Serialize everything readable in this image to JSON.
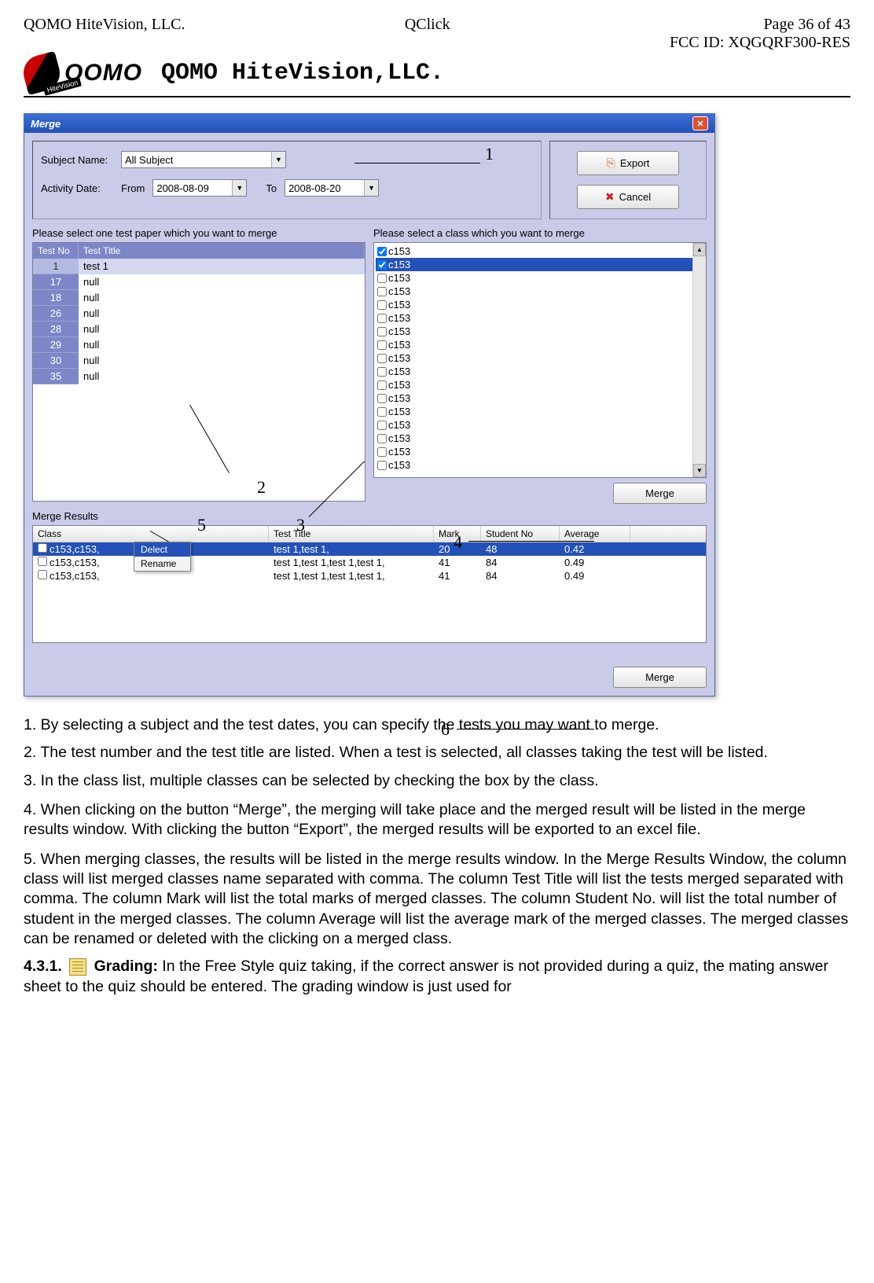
{
  "header": {
    "page": "Page 36 of 43",
    "left": "QOMO HiteVision, LLC.",
    "center": "QClick",
    "right": "FCC ID: XQGQRF300-RES",
    "logo_text": "QOMO",
    "logo_sub": "HiteVision",
    "company": "QOMO HiteVision,LLC."
  },
  "window": {
    "title": "Merge",
    "subject_label": "Subject Name:",
    "subject_value": "All Subject",
    "date_label": "Activity Date:",
    "from_label": "From",
    "from_value": "2008-08-09",
    "to_label": "To",
    "to_value": "2008-08-20",
    "export_label": "Export",
    "cancel_label": "Cancel",
    "test_group_label": "Please select one test paper which you want to merge",
    "class_group_label": "Please select a class which you want to merge",
    "test_headers": {
      "no": "Test No",
      "title": "Test Title"
    },
    "tests": [
      {
        "no": "1",
        "title": "test 1",
        "sel": true
      },
      {
        "no": "17",
        "title": "null"
      },
      {
        "no": "18",
        "title": "null"
      },
      {
        "no": "26",
        "title": "null"
      },
      {
        "no": "28",
        "title": "null"
      },
      {
        "no": "29",
        "title": "null"
      },
      {
        "no": "30",
        "title": "null"
      },
      {
        "no": "35",
        "title": "null"
      }
    ],
    "classes": [
      {
        "name": "c153",
        "checked": true,
        "hl": false
      },
      {
        "name": "c153",
        "checked": true,
        "hl": true
      },
      {
        "name": "c153"
      },
      {
        "name": "c153"
      },
      {
        "name": "c153"
      },
      {
        "name": "c153"
      },
      {
        "name": "c153"
      },
      {
        "name": "c153"
      },
      {
        "name": "c153"
      },
      {
        "name": "c153"
      },
      {
        "name": "c153"
      },
      {
        "name": "c153"
      },
      {
        "name": "c153"
      },
      {
        "name": "c153"
      },
      {
        "name": "c153"
      },
      {
        "name": "c153"
      },
      {
        "name": "c153"
      }
    ],
    "merge_button": "Merge",
    "results_label": "Merge Results",
    "results_headers": {
      "class": "Class",
      "title": "Test Title",
      "mark": "Mark",
      "student": "Student No",
      "avg": "Average"
    },
    "results": [
      {
        "class": "c153,c153,",
        "title": "test 1,test 1,",
        "mark": "20",
        "stud": "48",
        "avg": "0.42",
        "sel": true
      },
      {
        "class": "c153,c153,",
        "title": "test 1,test 1,test 1,test 1,",
        "mark": "41",
        "stud": "84",
        "avg": "0.49"
      },
      {
        "class": "c153,c153,",
        "title": "test 1,test 1,test 1,test 1,",
        "mark": "41",
        "stud": "84",
        "avg": "0.49"
      }
    ],
    "context_menu": {
      "delete": "Delect",
      "rename": "Rename"
    },
    "annotations": {
      "n1": "1",
      "n2": "2",
      "n3": "3",
      "n4": "4",
      "n5": "5",
      "n6": "6"
    }
  },
  "body": {
    "p1": "1. By selecting a subject and the test dates, you can specify the tests you may want to merge.",
    "p2": "2. The test number and the test title are listed. When a test is selected, all classes taking the test will be listed.",
    "p3": "3. In the class list, multiple classes can be selected by checking the box by the class.",
    "p4": "4. When clicking on the button “Merge”, the merging will take place and the merged result will be listed in the merge results window. With clicking the button “Export”, the merged results will be exported to an excel file.",
    "p5": "5. When merging classes, the results will be listed in the merge results window. In the Merge Results Window, the column class will list merged classes name separated with comma. The column Test Title will list the tests merged separated with comma. The column Mark will list the total marks of merged classes. The column Student No. will list the total number of student in the merged classes. The column Average will list the average mark of the merged classes. The merged classes can be renamed or deleted with the clicking on a merged class.",
    "p6_num": "4.3.1.",
    "p6_title": "Grading:",
    "p6_rest": " In the Free Style quiz taking, if the correct answer is not provided during a quiz, the mating answer sheet to the quiz should be entered. The grading window is just used for"
  }
}
